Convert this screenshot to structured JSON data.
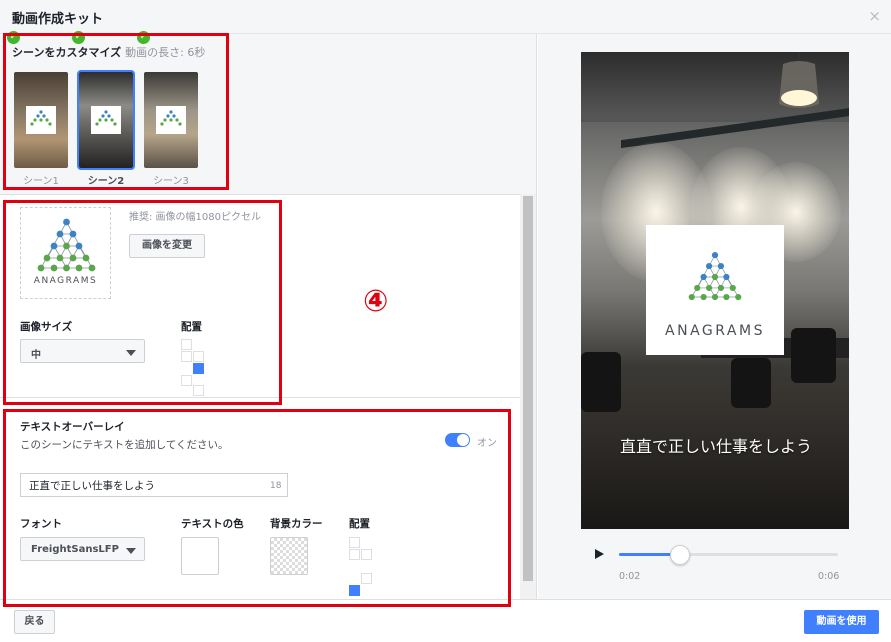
{
  "dialog": {
    "title": "動画作成キット",
    "close_icon": "×"
  },
  "scenes": {
    "heading": "シーンをカスタマイズ",
    "duration": "動画の長さ: 6秒",
    "items": [
      {
        "label": "シーン1",
        "checked": true,
        "selected": false
      },
      {
        "label": "シーン2",
        "checked": true,
        "selected": true
      },
      {
        "label": "シーン3",
        "checked": true,
        "selected": false
      }
    ]
  },
  "image_section": {
    "logo_brand": "ANAGRAMS",
    "recommendation": "推奨: 画像の幅1080ピクセル",
    "change_button": "画像を変更",
    "size_label": "画像サイズ",
    "size_value": "中",
    "placement_label": "配置",
    "placement_selected": "middle-right"
  },
  "annotation": {
    "marker": "④"
  },
  "text_overlay": {
    "heading": "テキストオーバーレイ",
    "description": "このシーンにテキストを追加してください。",
    "toggle_label": "オン",
    "toggle_on": true,
    "input_value": "正直で正しい仕事をしよう",
    "char_count": "18",
    "font_label": "フォント",
    "font_value": "FreightSansLFP",
    "text_color_label": "テキストの色",
    "bg_color_label": "背景カラー",
    "placement_label": "配置",
    "placement_selected": "bottom-left"
  },
  "preview": {
    "logo_brand": "ANAGRAMS",
    "overlay_text": "直直で正しい仕事をしよう",
    "time_current": "0:02",
    "time_total": "0:06",
    "progress": 0.28
  },
  "footer": {
    "back_button": "戻る",
    "use_button": "動画を使用"
  },
  "colors": {
    "accent": "#4080ff",
    "highlight": "#e0000f",
    "check": "#42b72a"
  }
}
